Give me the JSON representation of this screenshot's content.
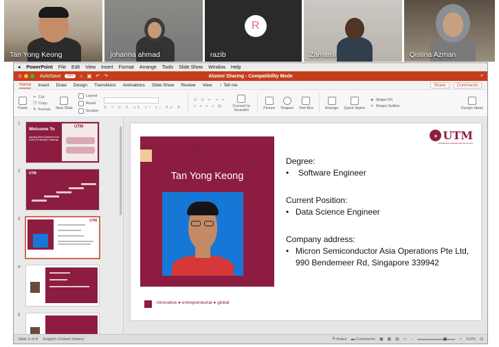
{
  "participants": [
    {
      "name": "Tan Yong Keong"
    },
    {
      "name": "johanna ahmad"
    },
    {
      "name": "razib",
      "initial": "R"
    },
    {
      "name": "Zamarul"
    },
    {
      "name": "Qistina Azman"
    }
  ],
  "mac_menu": {
    "app": "PowerPoint",
    "items": [
      "File",
      "Edit",
      "View",
      "Insert",
      "Format",
      "Arrange",
      "Tools",
      "Slide Show",
      "Window",
      "Help"
    ]
  },
  "titlebar": {
    "autosave": "AutoSave",
    "autosave_state": "OFF",
    "document": "Alumni Sharing - Compatibility Mode"
  },
  "ribbon_tabs": [
    "Home",
    "Insert",
    "Draw",
    "Design",
    "Transitions",
    "Animations",
    "Slide Show",
    "Review",
    "View",
    "Tell me"
  ],
  "ribbon_tab_active": "Home",
  "ribbon_right": {
    "share": "Share",
    "comments": "Comments"
  },
  "ribbon": {
    "paste": "Paste",
    "cut": "Cut",
    "copy": "Copy",
    "format": "Format",
    "new_slide": "New Slide",
    "layout": "Layout",
    "reset": "Reset",
    "section": "Section",
    "convert": "Convert to SmartArt",
    "picture": "Picture",
    "shapes": "Shapes",
    "text_box": "Text Box",
    "arrange": "Arrange",
    "quick_styles": "Quick Styles",
    "shape_fill": "Shape Fill",
    "shape_outline": "Shape Outline",
    "design_ideas": "Design Ideas"
  },
  "thumbnails": [
    {
      "number": "1",
      "title": "Welcome To",
      "subtitle": "Inspiring Work Experience And Covid 19 Pandemic Challenge"
    },
    {
      "number": "2",
      "title": "UTM"
    },
    {
      "number": "3",
      "selected": true
    },
    {
      "number": "4"
    },
    {
      "number": "5"
    }
  ],
  "slide": {
    "logo": "UTM",
    "logo_sub": "UNIVERSITI TEKNOLOGI MALAYSIA",
    "name": "Tan Yong Keong",
    "degree_label": "Degree:",
    "degree_value": "Software Engineer",
    "position_label": "Current Position:",
    "position_value": "Data Science Engineer",
    "address_label": "Company address:",
    "address_value": "Micron Semiconductor Asia Operations Pte Ltd, 990 Bendemeer Rd, Singapore 339942",
    "footer": "innovative ● entrepreneurial ● global"
  },
  "status": {
    "slide_info": "Slide 3 of 8",
    "language": "English (United States)",
    "notes": "Notes",
    "comments": "Comments",
    "zoom": "113%"
  },
  "colors": {
    "brand": "#8c1d40",
    "office_orange": "#c43e1c",
    "photo_bg": "#1677d6"
  }
}
